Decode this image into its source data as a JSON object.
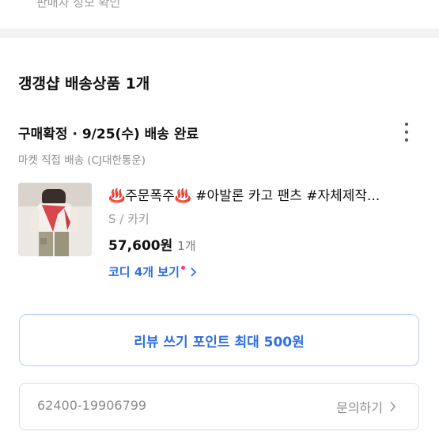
{
  "top": {
    "seller_info_label": "판매자 정보 확인"
  },
  "shop": {
    "title": "갱갱샵 배송상품 1개"
  },
  "order": {
    "status_line": "구매확정 · 9/25(수) 배송 완료",
    "shipping_method": "마켓 직접 배송 (CJ대한통운)"
  },
  "product": {
    "emoji_left": "♨️",
    "promo_text": "주문폭주",
    "emoji_right": "♨️",
    "title_rest": " #아발론 카고 팬츠 #자체제작...",
    "option": "S / 카키",
    "price": "57,600원",
    "quantity": "1개",
    "codi_link": "코디 4개 보기"
  },
  "actions": {
    "review_button": "리뷰 쓰기 포인트 최대 500원",
    "order_number": "62400-19906799",
    "inquiry_label": "문의하기"
  },
  "colors": {
    "accent_blue": "#2f6fe4",
    "review_border": "#b7cdf6",
    "new_dot": "#ff3a6a",
    "band_gray": "#f2f3f5"
  },
  "icons": {
    "more": "more-vertical-icon",
    "chevron": "chevron-right-icon",
    "top_chevron": "chevron-down-icon"
  }
}
